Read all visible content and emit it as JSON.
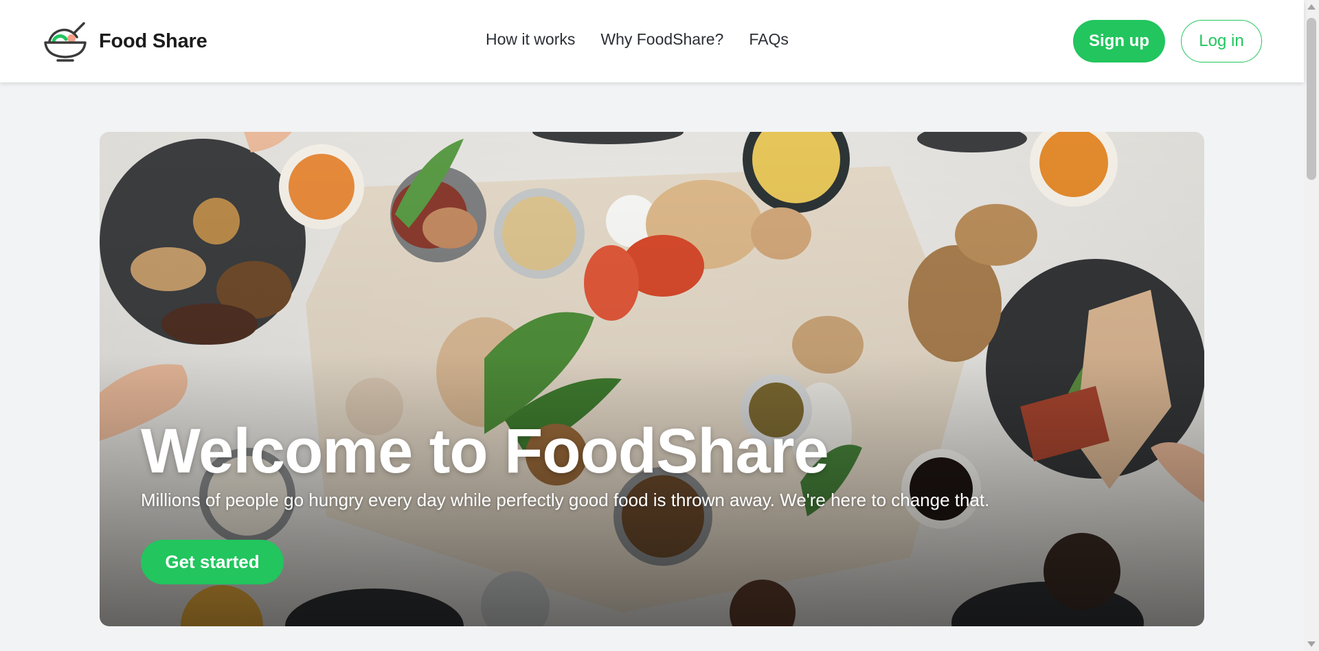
{
  "navbar": {
    "brand_name": "Food Share",
    "logo_icon": "bowl-icon",
    "links": [
      {
        "label": "How it works"
      },
      {
        "label": "Why FoodShare?"
      },
      {
        "label": "FAQs"
      }
    ],
    "signup_label": "Sign up",
    "login_label": "Log in"
  },
  "hero": {
    "title": "Welcome to FoodShare",
    "subtitle": "Millions of people go hungry every day while perfectly good food is thrown away. We're here to change that.",
    "cta_label": "Get started",
    "background_image": "shared-food-table-photo"
  },
  "colors": {
    "accent": "#22c55e",
    "page_background": "#f2f3f5",
    "nav_text": "#2b2f36",
    "brand_text": "#1c1c1c"
  }
}
